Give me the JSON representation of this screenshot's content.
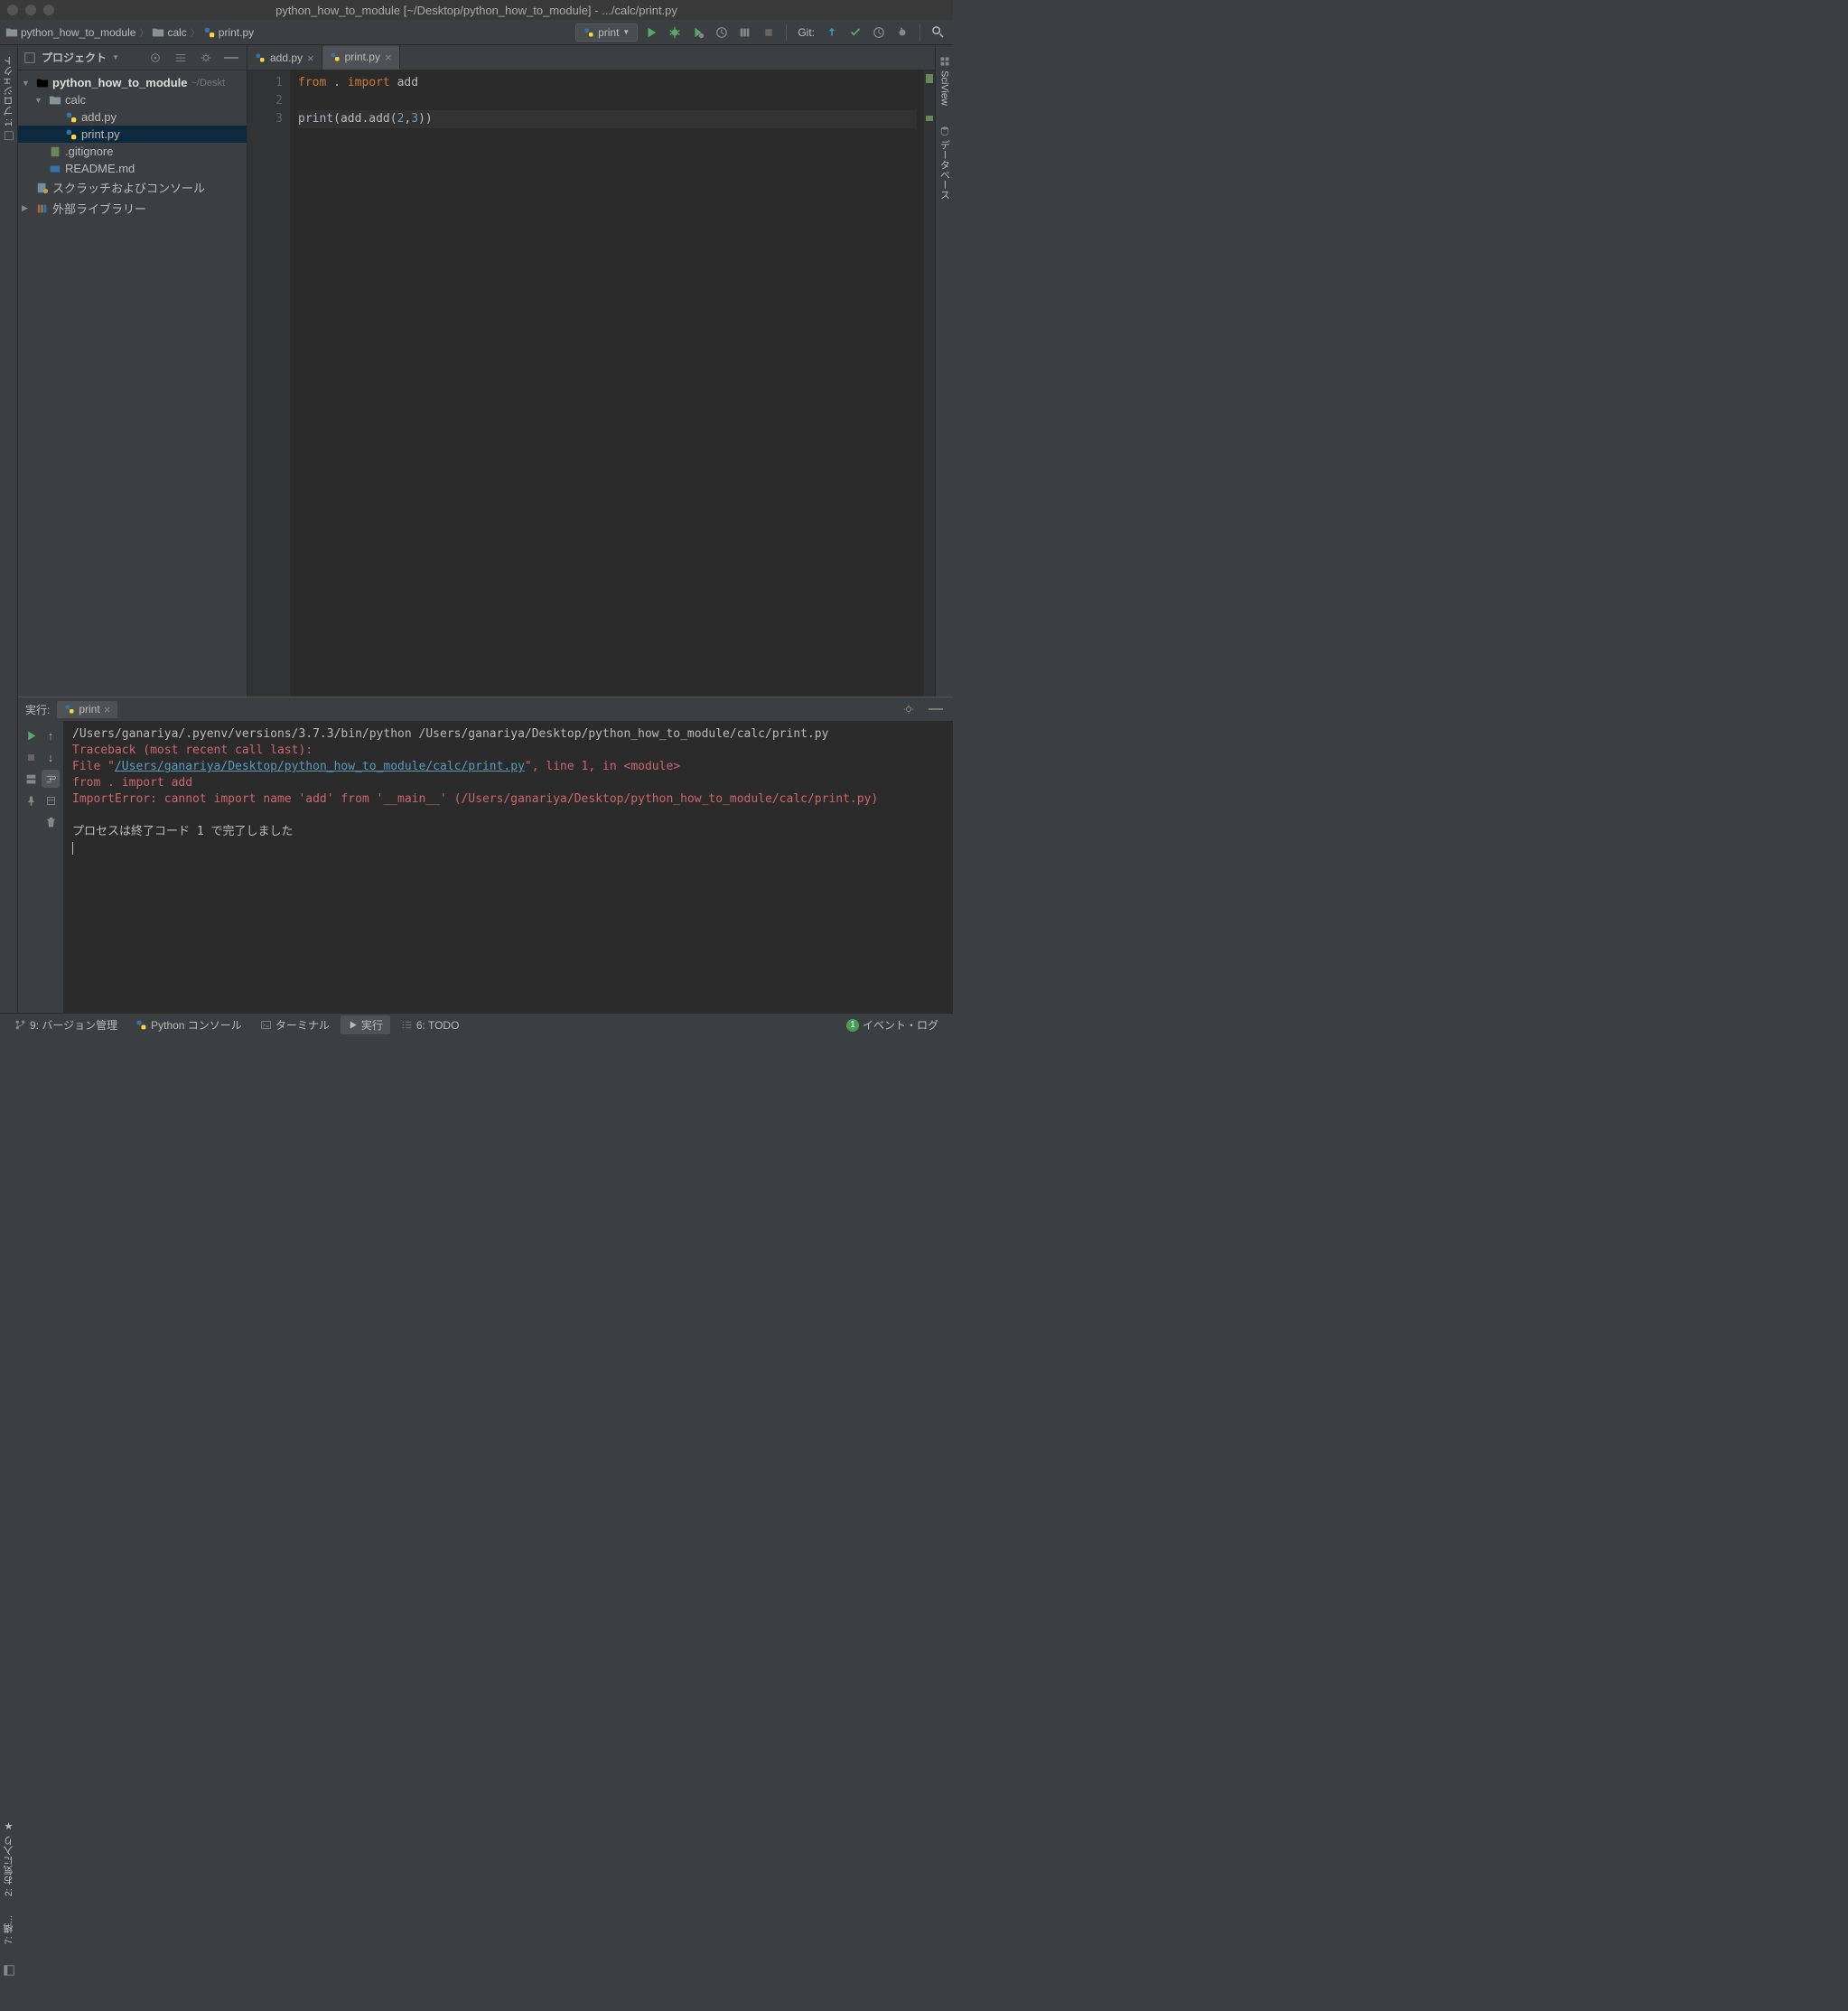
{
  "titlebar": {
    "title": "python_how_to_module [~/Desktop/python_how_to_module] - .../calc/print.py"
  },
  "breadcrumbs": [
    {
      "icon": "folder",
      "label": "python_how_to_module"
    },
    {
      "icon": "folder",
      "label": "calc"
    },
    {
      "icon": "python",
      "label": "print.py"
    }
  ],
  "run_config": {
    "icon": "python",
    "label": "print"
  },
  "git_label": "Git:",
  "left_gutter": {
    "project_tab": "1: プロジェクト"
  },
  "right_gutter": {
    "sciview": "SciView",
    "database": "データベース"
  },
  "project_panel": {
    "title": "プロジェクト",
    "tree": [
      {
        "type": "root",
        "label": "python_how_to_module",
        "hint": "~/Deskt",
        "expanded": true
      },
      {
        "type": "folder",
        "label": "calc",
        "expanded": true,
        "indent": 1
      },
      {
        "type": "py",
        "label": "add.py",
        "indent": 2
      },
      {
        "type": "py",
        "label": "print.py",
        "indent": 2,
        "selected": true
      },
      {
        "type": "file",
        "label": ".gitignore",
        "indent": 1
      },
      {
        "type": "md",
        "label": "README.md",
        "indent": 1
      },
      {
        "type": "scratch",
        "label": "スクラッチおよびコンソール",
        "indent": 0
      },
      {
        "type": "lib",
        "label": "外部ライブラリー",
        "indent": 0,
        "collapsed": true
      }
    ]
  },
  "editor": {
    "tabs": [
      {
        "icon": "python",
        "label": "add.py",
        "active": false
      },
      {
        "icon": "python",
        "label": "print.py",
        "active": true
      }
    ],
    "lines": [
      {
        "num": "1",
        "tokens": [
          {
            "t": "from",
            "c": "kw"
          },
          {
            "t": " . "
          },
          {
            "t": "import",
            "c": "kw"
          },
          {
            "t": " add"
          }
        ]
      },
      {
        "num": "2",
        "tokens": []
      },
      {
        "num": "3",
        "current": true,
        "tokens": [
          {
            "t": "print",
            "c": "fn"
          },
          {
            "t": "(add.add("
          },
          {
            "t": "2",
            "c": "num"
          },
          {
            "t": ","
          },
          {
            "t": "3",
            "c": "num"
          },
          {
            "t": "))"
          }
        ]
      }
    ]
  },
  "run_panel": {
    "label": "実行:",
    "tab": "print",
    "output": {
      "cmd": "/Users/ganariya/.pyenv/versions/3.7.3/bin/python /Users/ganariya/Desktop/python_how_to_module/calc/print.py",
      "trace1": "Traceback (most recent call last):",
      "trace2a": "  File \"",
      "trace2link": "/Users/ganariya/Desktop/python_how_to_module/calc/print.py",
      "trace2b": "\", line 1, in <module>",
      "trace3": "    from . import add",
      "trace4": "ImportError: cannot import name 'add' from '__main__' (/Users/ganariya/Desktop/python_how_to_module/calc/print.py)",
      "exit": "プロセスは終了コード 1 で完了しました"
    }
  },
  "left_bottom": {
    "fav": "2: お気に入り",
    "struct": "7: 構..."
  },
  "statusbar": {
    "vcs": "9: バージョン管理",
    "pyconsole": "Python コンソール",
    "terminal": "ターミナル",
    "run": "実行",
    "todo": "6: TODO",
    "event_log": "イベント・ログ",
    "event_badge": "1"
  }
}
